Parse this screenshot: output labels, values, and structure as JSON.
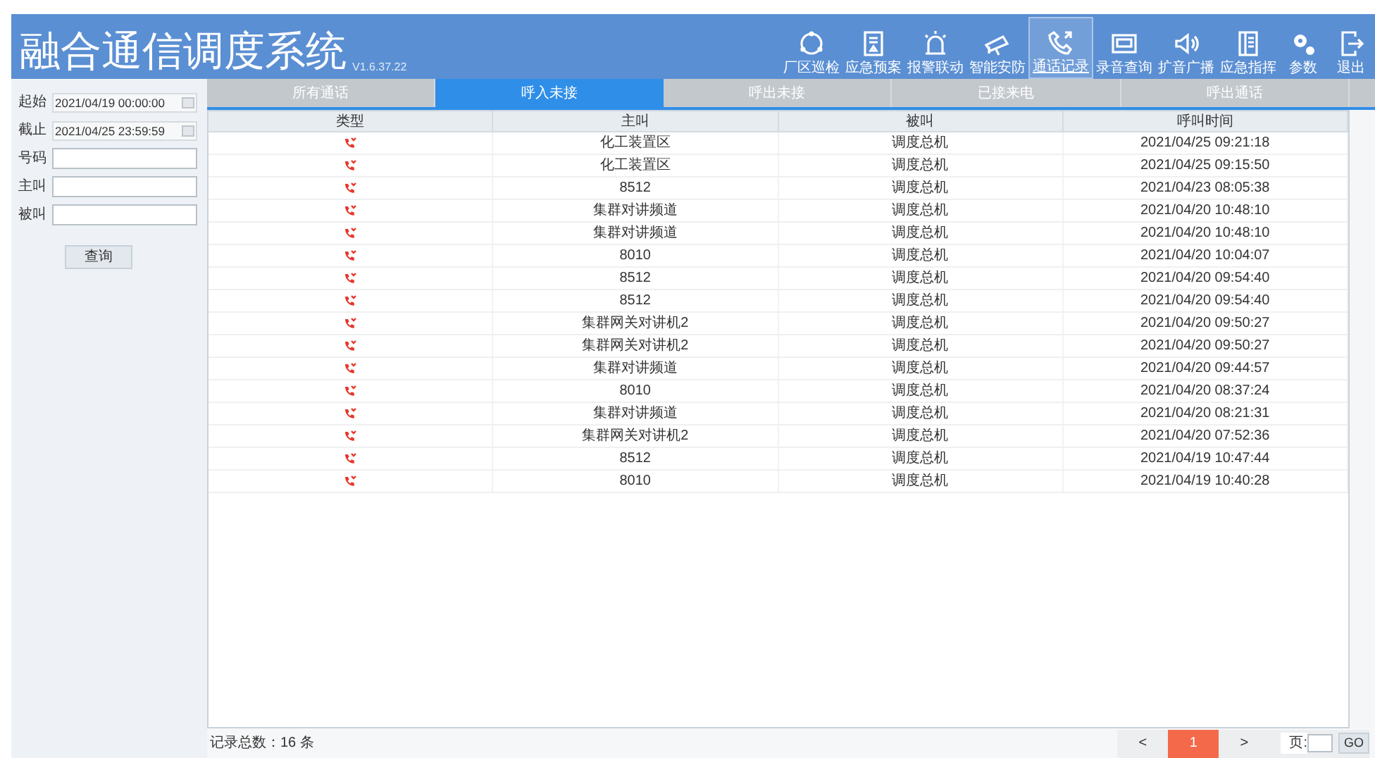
{
  "header": {
    "title": "融合通信调度系统",
    "version": "V1.6.37.22"
  },
  "toolbar": [
    {
      "label": "厂区巡检",
      "selected": false
    },
    {
      "label": "应急预案",
      "selected": false
    },
    {
      "label": "报警联动",
      "selected": false
    },
    {
      "label": "智能安防",
      "selected": false
    },
    {
      "label": "通话记录",
      "selected": true
    },
    {
      "label": "录音查询",
      "selected": false
    },
    {
      "label": "扩音广播",
      "selected": false
    },
    {
      "label": "应急指挥",
      "selected": false
    },
    {
      "label": "参数",
      "selected": false
    },
    {
      "label": "退出",
      "selected": false
    }
  ],
  "filters": [
    {
      "label": "起始",
      "value": "2021/04/19 00:00:00",
      "kind": "date"
    },
    {
      "label": "截止",
      "value": "2021/04/25 23:59:59",
      "kind": "date"
    },
    {
      "label": "号码",
      "kind": "text"
    },
    {
      "label": "主叫",
      "kind": "text"
    },
    {
      "label": "被叫",
      "kind": "text"
    }
  ],
  "query_button": "查询",
  "tabs": [
    {
      "label": "所有通话",
      "selected": false
    },
    {
      "label": "呼入未接",
      "selected": true
    },
    {
      "label": "呼出未接",
      "selected": false
    },
    {
      "label": "已接来电",
      "selected": false
    },
    {
      "label": "呼出通话",
      "selected": false
    }
  ],
  "table": {
    "columns": [
      "类型",
      "主叫",
      "被叫",
      "呼叫时间"
    ],
    "rows": [
      {
        "caller": "化工装置区",
        "callee": "调度总机",
        "time": "2021/04/25 09:21:18"
      },
      {
        "caller": "化工装置区",
        "callee": "调度总机",
        "time": "2021/04/25 09:15:50"
      },
      {
        "caller": "8512",
        "callee": "调度总机",
        "time": "2021/04/23 08:05:38"
      },
      {
        "caller": "集群对讲频道",
        "callee": "调度总机",
        "time": "2021/04/20 10:48:10"
      },
      {
        "caller": "集群对讲频道",
        "callee": "调度总机",
        "time": "2021/04/20 10:48:10"
      },
      {
        "caller": "8010",
        "callee": "调度总机",
        "time": "2021/04/20 10:04:07"
      },
      {
        "caller": "8512",
        "callee": "调度总机",
        "time": "2021/04/20 09:54:40"
      },
      {
        "caller": "8512",
        "callee": "调度总机",
        "time": "2021/04/20 09:54:40"
      },
      {
        "caller": "集群网关对讲机2",
        "callee": "调度总机",
        "time": "2021/04/20 09:50:27"
      },
      {
        "caller": "集群网关对讲机2",
        "callee": "调度总机",
        "time": "2021/04/20 09:50:27"
      },
      {
        "caller": "集群对讲频道",
        "callee": "调度总机",
        "time": "2021/04/20 09:44:57"
      },
      {
        "caller": "8010",
        "callee": "调度总机",
        "time": "2021/04/20 08:37:24"
      },
      {
        "caller": "集群对讲频道",
        "callee": "调度总机",
        "time": "2021/04/20 08:21:31"
      },
      {
        "caller": "集群网关对讲机2",
        "callee": "调度总机",
        "time": "2021/04/20 07:52:36"
      },
      {
        "caller": "8512",
        "callee": "调度总机",
        "time": "2021/04/19 10:47:44"
      },
      {
        "caller": "8010",
        "callee": "调度总机",
        "time": "2021/04/19 10:40:28"
      }
    ]
  },
  "footer": {
    "total": "记录总数：16 条",
    "prev": "<",
    "pages": [
      {
        "label": "1",
        "selected": true
      }
    ],
    "next": ">",
    "page_label": "页:",
    "go": "GO"
  }
}
